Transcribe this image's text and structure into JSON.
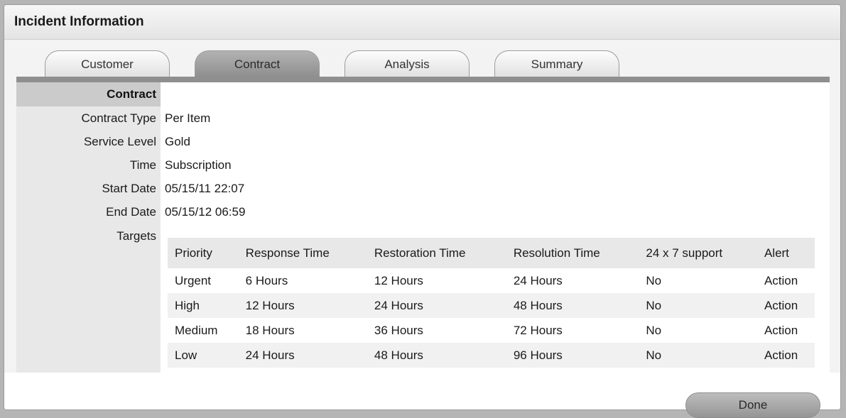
{
  "window": {
    "title": "Incident Information"
  },
  "tabs": [
    {
      "label": "Customer"
    },
    {
      "label": "Contract"
    },
    {
      "label": "Analysis"
    },
    {
      "label": "Summary"
    }
  ],
  "active_tab": "Contract",
  "contract": {
    "section_title": "Contract",
    "fields": [
      {
        "label": "Contract Type",
        "value": "Per Item"
      },
      {
        "label": "Service Level",
        "value": "Gold"
      },
      {
        "label": "Time",
        "value": "Subscription"
      },
      {
        "label": "Start Date",
        "value": "05/15/11 22:07"
      },
      {
        "label": "End Date",
        "value": "05/15/12 06:59"
      }
    ],
    "targets_label": "Targets",
    "targets": {
      "columns": [
        "Priority",
        "Response Time",
        "Restoration Time",
        "Resolution Time",
        "24 x 7 support",
        "Alert"
      ],
      "rows": [
        [
          "Urgent",
          "6 Hours",
          "12 Hours",
          "24 Hours",
          "No",
          "Action"
        ],
        [
          "High",
          "12 Hours",
          "24 Hours",
          "48 Hours",
          "No",
          "Action"
        ],
        [
          "Medium",
          "18 Hours",
          "36 Hours",
          "72 Hours",
          "No",
          "Action"
        ],
        [
          "Low",
          "24 Hours",
          "48 Hours",
          "96 Hours",
          "No",
          "Action"
        ]
      ]
    }
  },
  "actions": {
    "done_label": "Done"
  }
}
